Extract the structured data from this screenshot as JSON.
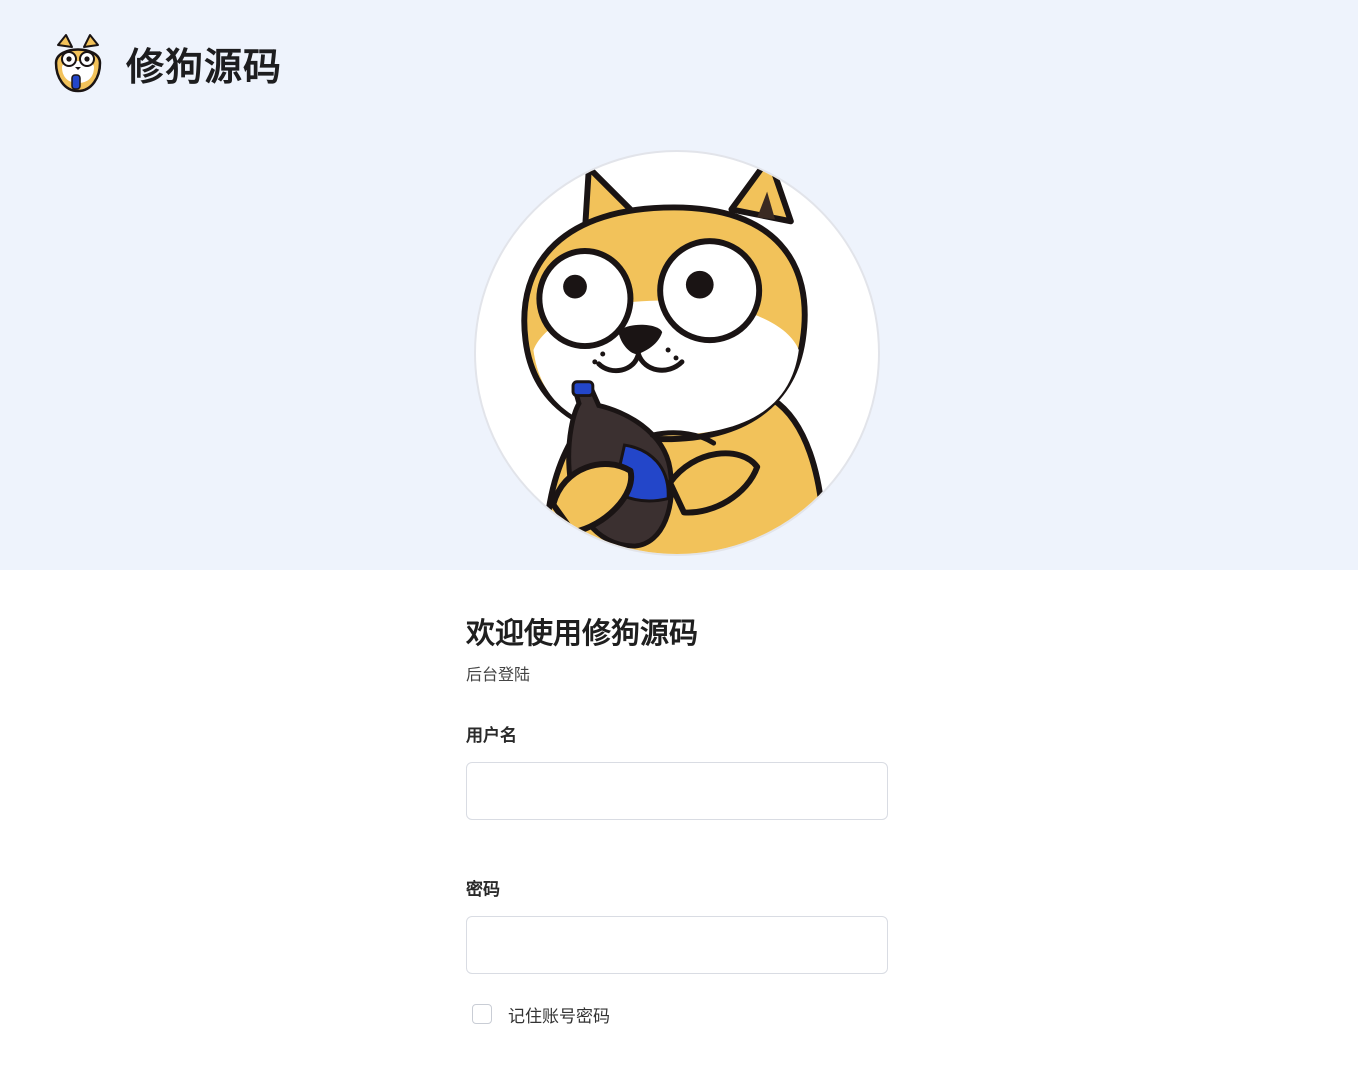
{
  "brand": {
    "title": "修狗源码",
    "logo_icon": "shiba-dog-logo-icon"
  },
  "hero": {
    "background_color": "#eef3fc",
    "avatar_icon": "shiba-dog-holding-bottle-icon"
  },
  "login": {
    "title": "欢迎使用修狗源码",
    "subtitle": "后台登陆",
    "username_label": "用户名",
    "username_value": "",
    "password_label": "密码",
    "password_value": "",
    "remember_label": "记住账号密码",
    "remember_checked": false
  },
  "colors": {
    "dog_orange": "#f2c25a",
    "outline": "#1a1414",
    "bottle_blue": "#2346c9"
  }
}
